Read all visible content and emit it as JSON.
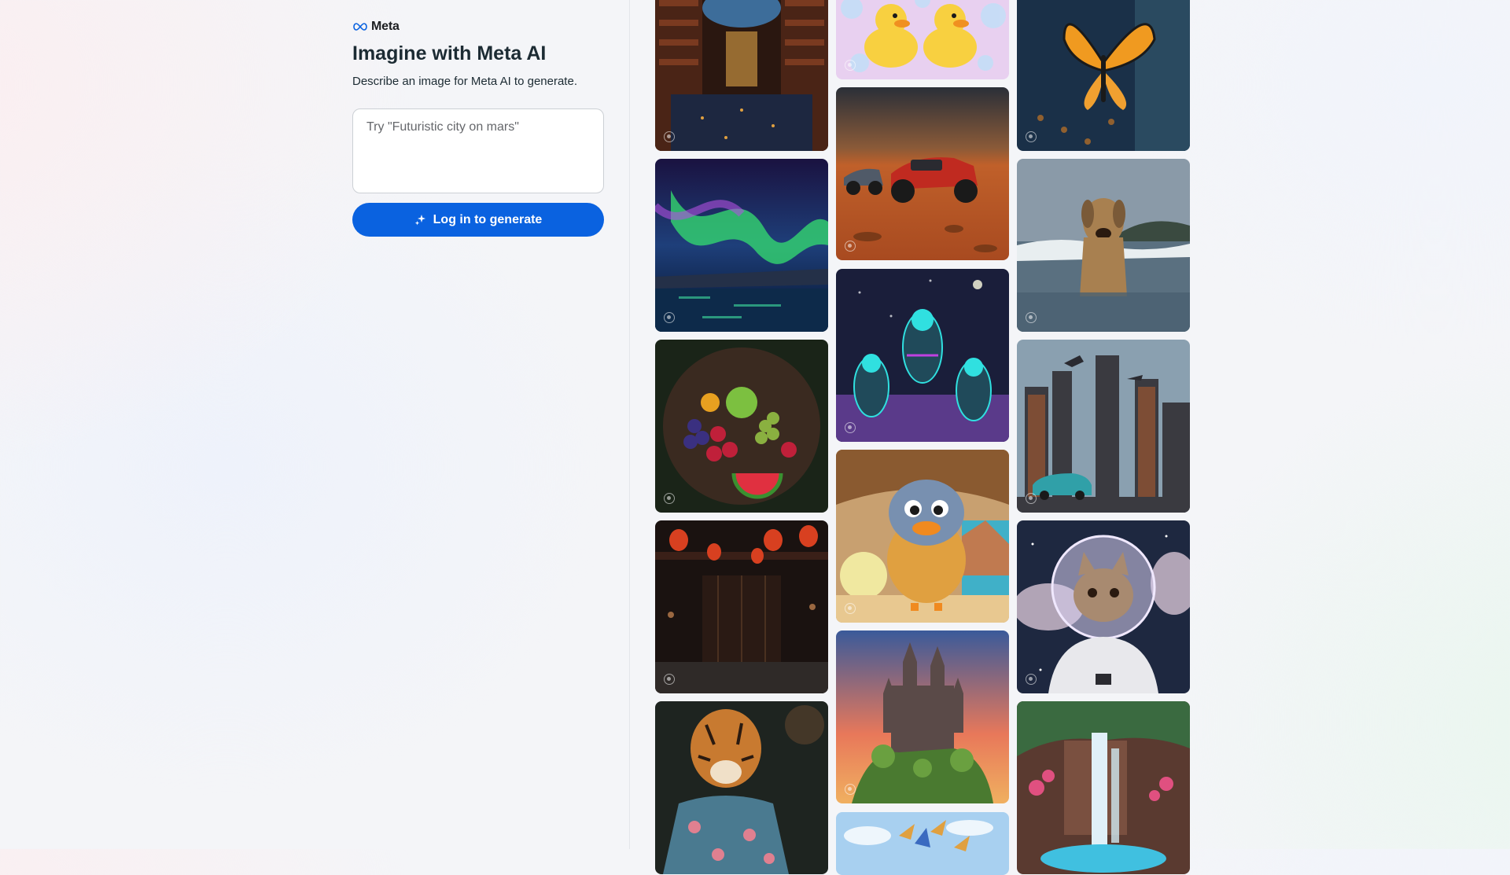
{
  "brand": {
    "name": "Meta",
    "accent": "#0a62e0"
  },
  "header": {
    "title": "Imagine with Meta AI",
    "subtitle": "Describe an image for Meta AI to generate."
  },
  "prompt": {
    "placeholder": "Try \"Futuristic city on mars\"",
    "value": ""
  },
  "generate_button": {
    "label": "Log in to generate",
    "icon": "sparkle-icon"
  },
  "gallery": {
    "columns": [
      [
        "library",
        "aurora",
        "fruit-bowl",
        "lantern-restaurant",
        "tiger-in-suit"
      ],
      [
        "rubber-ducks",
        "mars-car",
        "space-cats",
        "fluffy-bird",
        "castle",
        "paper-birds"
      ],
      [
        "butterfly",
        "dog-in-sea",
        "futuristic-city",
        "astronaut-cat",
        "waterfall"
      ]
    ]
  }
}
